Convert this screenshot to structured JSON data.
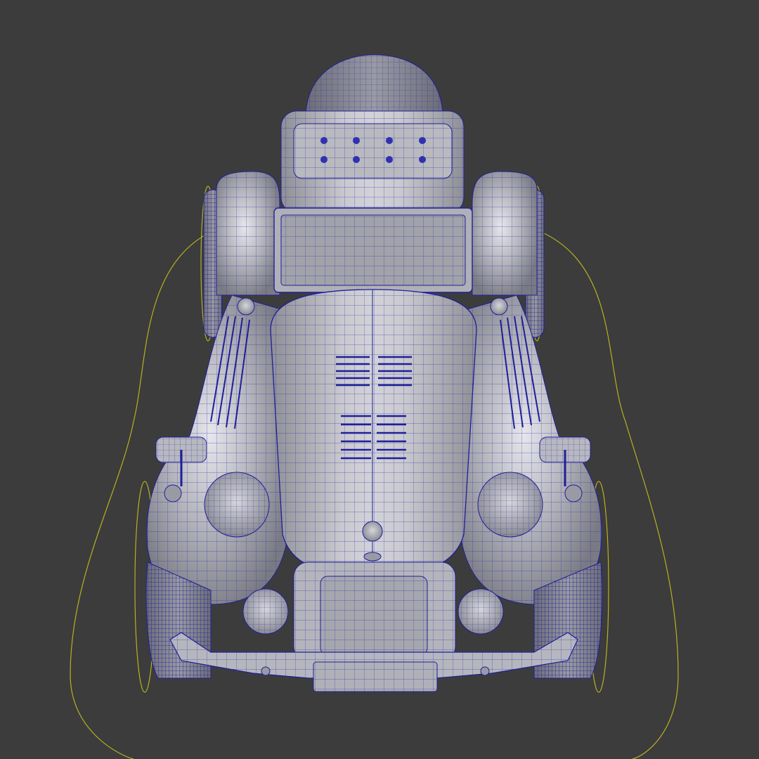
{
  "viewport": {
    "background": "#3c3c3c",
    "shading": "gray-matcap",
    "wireframe_color": "#1a1a9e",
    "curve_color": "#b8b020",
    "subject": "vintage-roadster-front-view"
  },
  "colors": {
    "body_light": "#c8c8cc",
    "body_mid": "#a8a8ae",
    "body_dark": "#6e6e76",
    "tire": "#8a8a92"
  }
}
